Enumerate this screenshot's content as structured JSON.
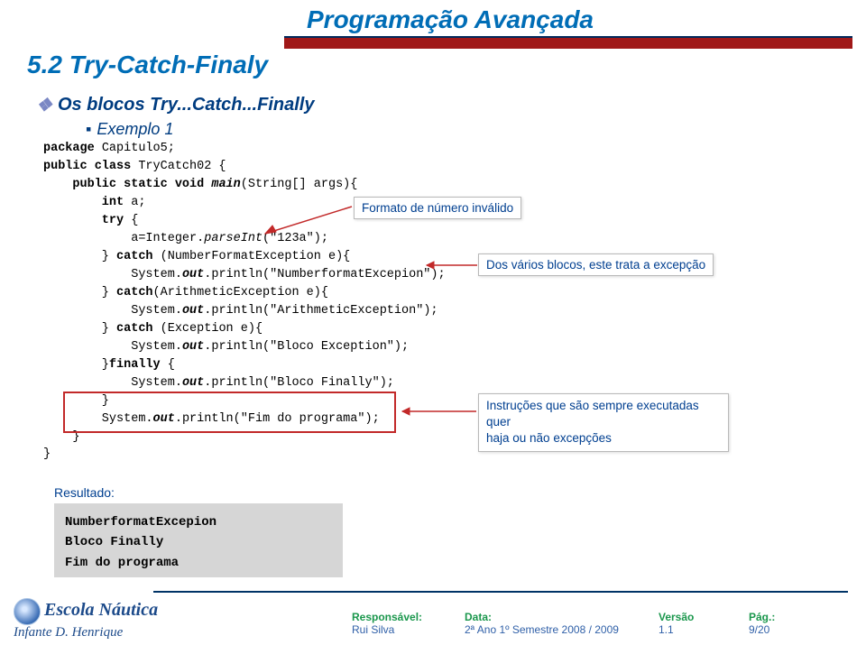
{
  "header": {
    "course_title": "Programação Avançada",
    "section_title": "5.2 Try-Catch-Finaly"
  },
  "bullets": {
    "main": "Os blocos Try...Catch...Finally",
    "sub": "Exemplo 1"
  },
  "code": {
    "l1_a": "package",
    "l1_b": " Capitulo5;",
    "l2_a": "public class",
    "l2_b": " TryCatch02 {",
    "l3_a": "    public static void ",
    "l3_b": "main",
    "l3_c": "(String[] args){",
    "l4_a": "        int",
    "l4_b": " a;",
    "l5_a": "        try",
    "l5_b": " {",
    "l6_a": "            a=Integer.",
    "l6_b": "parseInt",
    "l6_c": "(",
    "l6_d": "\"123a\"",
    "l6_e": ");",
    "l7_a": "        } ",
    "l7_b": "catch",
    "l7_c": " (NumberFormatException e){",
    "l8_a": "            System.",
    "l8_b": "out",
    "l8_c": ".println(",
    "l8_d": "\"NumberformatExcepion\"",
    "l8_e": ");",
    "l9_a": "        } ",
    "l9_b": "catch",
    "l9_c": "(ArithmeticException e){",
    "l10_a": "            System.",
    "l10_b": "out",
    "l10_c": ".println(",
    "l10_d": "\"ArithmeticException\"",
    "l10_e": ");",
    "l11_a": "        } ",
    "l11_b": "catch",
    "l11_c": " (Exception e){",
    "l12_a": "            System.",
    "l12_b": "out",
    "l12_c": ".println(",
    "l12_d": "\"Bloco Exception\"",
    "l12_e": ");",
    "l13_a": "        }",
    "l13_b": "finally",
    "l13_c": " {",
    "l14_a": "            System.",
    "l14_b": "out",
    "l14_c": ".println(",
    "l14_d": "\"Bloco Finally\"",
    "l14_e": ");",
    "l15": "        }",
    "l16_a": "        System.",
    "l16_b": "out",
    "l16_c": ".println(",
    "l16_d": "\"Fim do programa\"",
    "l16_e": ");",
    "l17": "    }",
    "l18": "}"
  },
  "annotations": {
    "format": "Formato de número inválido",
    "blocos": "Dos vários blocos, este trata a excepção",
    "instr_l1": "Instruções que são sempre executadas quer",
    "instr_l2": "haja ou não excepções"
  },
  "result": {
    "label": "Resultado:",
    "line1": "NumberformatExcepion",
    "line2": "Bloco Finally",
    "line3": "Fim do programa"
  },
  "footer": {
    "school1": "Escola Náutica",
    "school2": "Infante D. Henrique",
    "resp_lbl": "Responsável:",
    "resp_val": "Rui Silva",
    "data_lbl": "Data:",
    "data_val": "2ª Ano 1º Semestre 2008 / 2009",
    "ver_lbl": "Versão",
    "ver_val": "1.1",
    "pag_lbl": "Pág.:",
    "pag_val": "9/20"
  }
}
